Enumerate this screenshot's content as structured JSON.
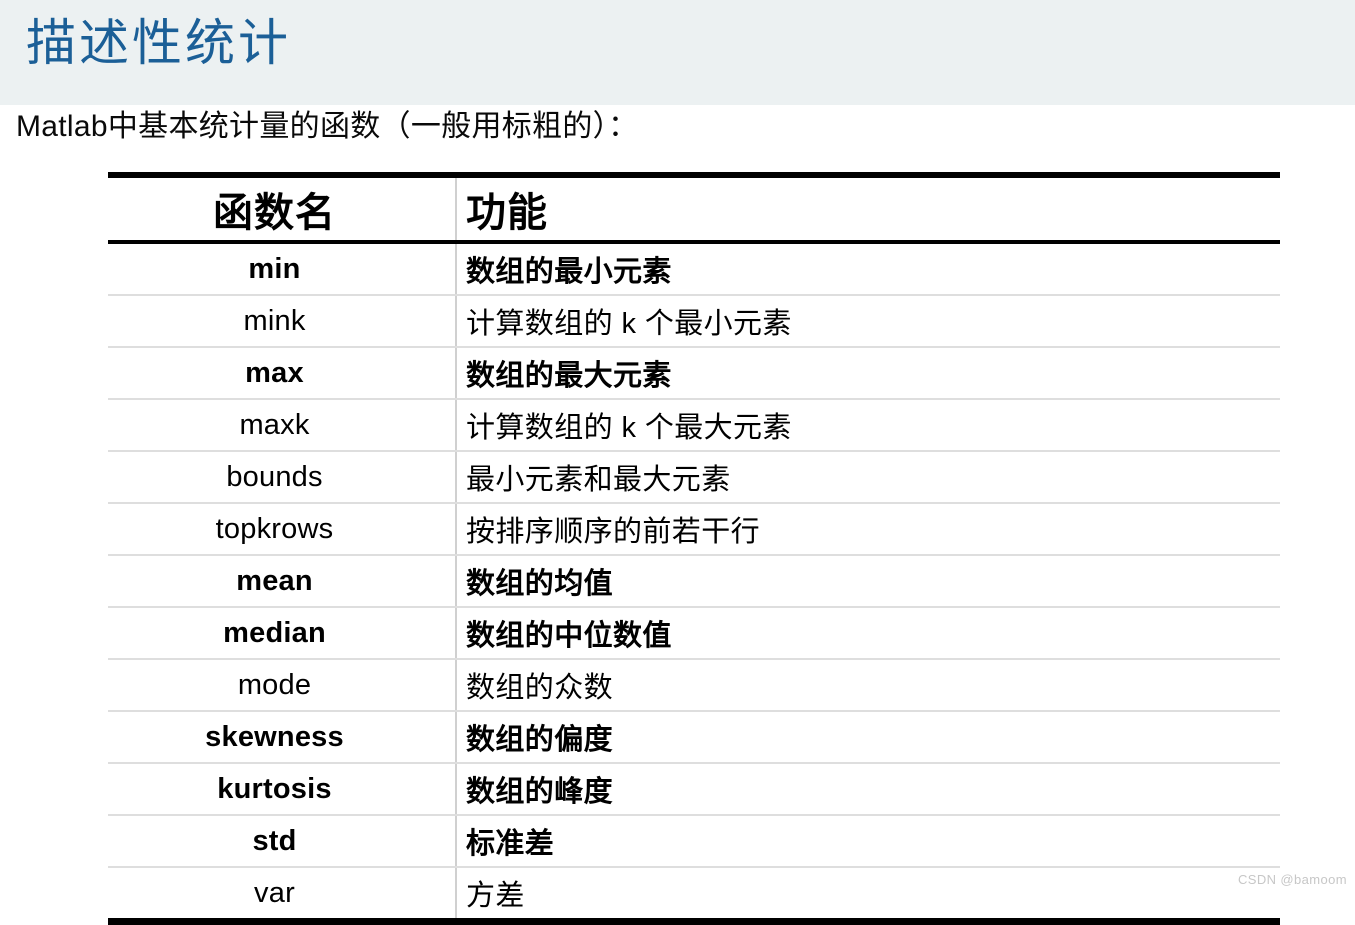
{
  "slide": {
    "title": "描述性统计",
    "title_color": "#1b5f97",
    "banner_color": "#ecf1f2",
    "subtitle": "Matlab中基本统计量的函数（一般用标粗的）："
  },
  "table": {
    "columns": [
      "函数名",
      "功能"
    ],
    "rows": [
      {
        "name": "min",
        "desc": "数组的最小元素",
        "bold": true
      },
      {
        "name": "mink",
        "desc": "计算数组的 k 个最小元素",
        "bold": false
      },
      {
        "name": "max",
        "desc": "数组的最大元素",
        "bold": true
      },
      {
        "name": "maxk",
        "desc": "计算数组的 k 个最大元素",
        "bold": false
      },
      {
        "name": "bounds",
        "desc": "最小元素和最大元素",
        "bold": false
      },
      {
        "name": "topkrows",
        "desc": "按排序顺序的前若干行",
        "bold": false
      },
      {
        "name": "mean",
        "desc": "数组的均值",
        "bold": true
      },
      {
        "name": "median",
        "desc": "数组的中位数值",
        "bold": true
      },
      {
        "name": "mode",
        "desc": "数组的众数",
        "bold": false
      },
      {
        "name": "skewness",
        "desc": "数组的偏度",
        "bold": true
      },
      {
        "name": "kurtosis",
        "desc": "数组的峰度",
        "bold": true
      },
      {
        "name": "std",
        "desc": "标准差",
        "bold": true
      },
      {
        "name": "var",
        "desc": "方差",
        "bold": false
      }
    ]
  },
  "watermark": {
    "text": "CSDN @bamoom"
  }
}
